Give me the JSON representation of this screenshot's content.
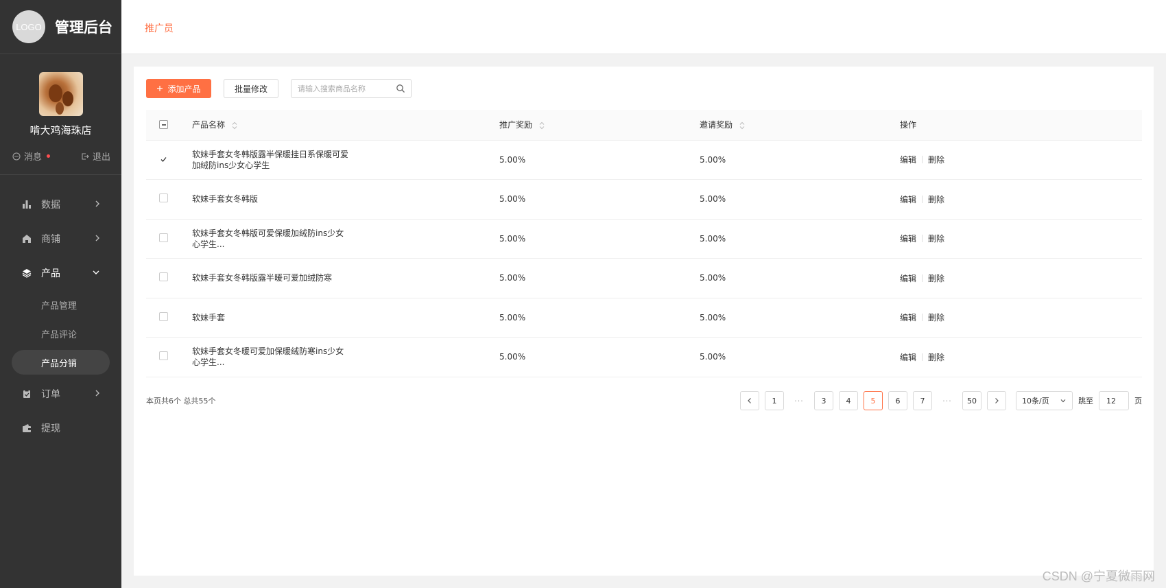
{
  "brand": {
    "logo_text": "LOGO",
    "title": "管理后台"
  },
  "profile": {
    "shop_name": "啃大鸡海珠店",
    "messages_label": "消息",
    "logout_label": "退出"
  },
  "menu": {
    "data_label": "数据",
    "shop_label": "商铺",
    "product_label": "产品",
    "product_sub": [
      "产品管理",
      "产品评论",
      "产品分销"
    ],
    "orders_label": "订单",
    "withdraw_label": "提现"
  },
  "header": {
    "breadcrumb": "推广员"
  },
  "toolbar": {
    "add_label": "添加产品",
    "batch_label": "批量修改",
    "search_placeholder": "请输入搜索商品名称"
  },
  "table": {
    "headers": {
      "name": "产品名称",
      "promo": "推广奖励",
      "invite": "邀请奖励",
      "actions": "操作"
    },
    "edit_label": "编辑",
    "delete_label": "删除",
    "rows": [
      {
        "name": "软妹手套女冬韩版露半保暖挂日系保暖可爱加绒防ins少女心学生",
        "promo": "5.00%",
        "invite": "5.00%",
        "checked": true
      },
      {
        "name": "软妹手套女冬韩版",
        "promo": "5.00%",
        "invite": "5.00%",
        "checked": false
      },
      {
        "name": "软妹手套女冬韩版可爱保暖加绒防ins少女心学生...",
        "promo": "5.00%",
        "invite": "5.00%",
        "checked": false
      },
      {
        "name": "软妹手套女冬韩版露半暖可爱加绒防寒",
        "promo": "5.00%",
        "invite": "5.00%",
        "checked": false
      },
      {
        "name": "软妹手套",
        "promo": "5.00%",
        "invite": "5.00%",
        "checked": false
      },
      {
        "name": "软妹手套女冬暖可爱加保暖绒防寒ins少女心学生...",
        "promo": "5.00%",
        "invite": "5.00%",
        "checked": false
      }
    ]
  },
  "footer": {
    "summary": "本页共6个  总共55个",
    "pages": [
      "1",
      "3",
      "4",
      "5",
      "6",
      "7",
      "50"
    ],
    "ellipsis": "···",
    "page_size": "10条/页",
    "jump_label": "跳至",
    "jump_value": "12",
    "page_unit": "页"
  },
  "watermark": "CSDN @宁夏微雨网",
  "colors": {
    "accent": "#ff7043",
    "sidebar": "#333333"
  }
}
